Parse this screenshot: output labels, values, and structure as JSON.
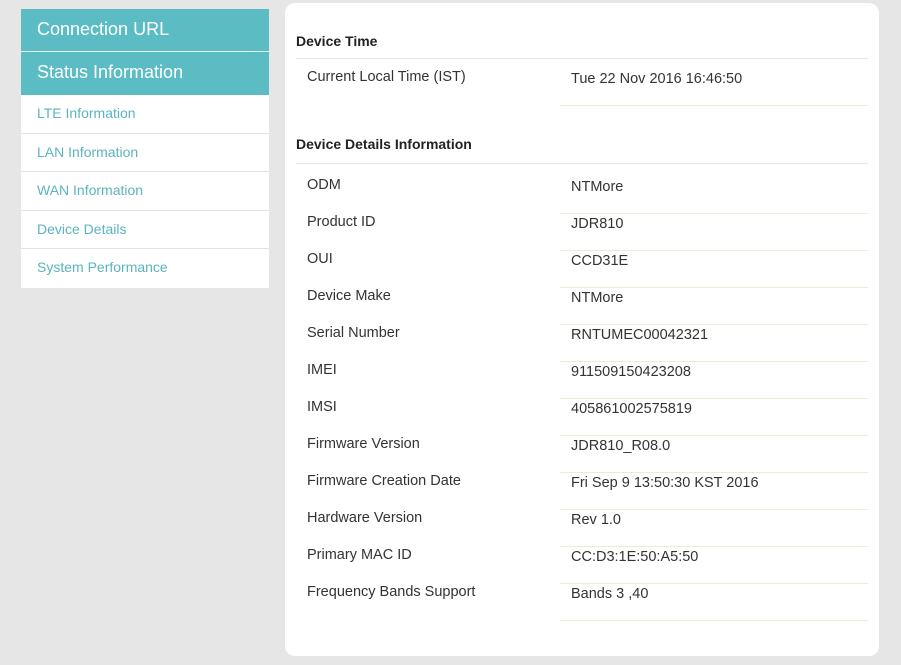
{
  "sidebar": {
    "headers": [
      {
        "label": "Connection URL"
      },
      {
        "label": "Status Information"
      }
    ],
    "items": [
      {
        "label": "LTE Information"
      },
      {
        "label": "LAN Information"
      },
      {
        "label": "WAN Information"
      },
      {
        "label": "Device Details"
      },
      {
        "label": "System Performance"
      }
    ]
  },
  "device_time": {
    "title": "Device Time",
    "rows": [
      {
        "label": "Current Local Time (IST)",
        "value": "Tue 22 Nov 2016 16:46:50"
      }
    ]
  },
  "device_details": {
    "title": "Device Details Information",
    "rows": [
      {
        "label": "ODM",
        "value": "NTMore"
      },
      {
        "label": "Product ID",
        "value": "JDR810"
      },
      {
        "label": "OUI",
        "value": "CCD31E"
      },
      {
        "label": "Device Make",
        "value": "NTMore"
      },
      {
        "label": "Serial Number",
        "value": "RNTUMEC00042321"
      },
      {
        "label": "IMEI",
        "value": "911509150423208"
      },
      {
        "label": "IMSI",
        "value": "405861002575819"
      },
      {
        "label": "Firmware Version",
        "value": "JDR810_R08.0"
      },
      {
        "label": "Firmware Creation Date",
        "value": "Fri Sep 9 13:50:30 KST 2016"
      },
      {
        "label": "Hardware Version",
        "value": "Rev 1.0"
      },
      {
        "label": "Primary MAC ID",
        "value": "CC:D3:1E:50:A5:50"
      },
      {
        "label": "Frequency Bands Support",
        "value": "Bands 3 ,40"
      }
    ]
  },
  "colors": {
    "accent": "#5bbcc4",
    "link": "#5bb4be",
    "background": "#e6e6e6"
  }
}
